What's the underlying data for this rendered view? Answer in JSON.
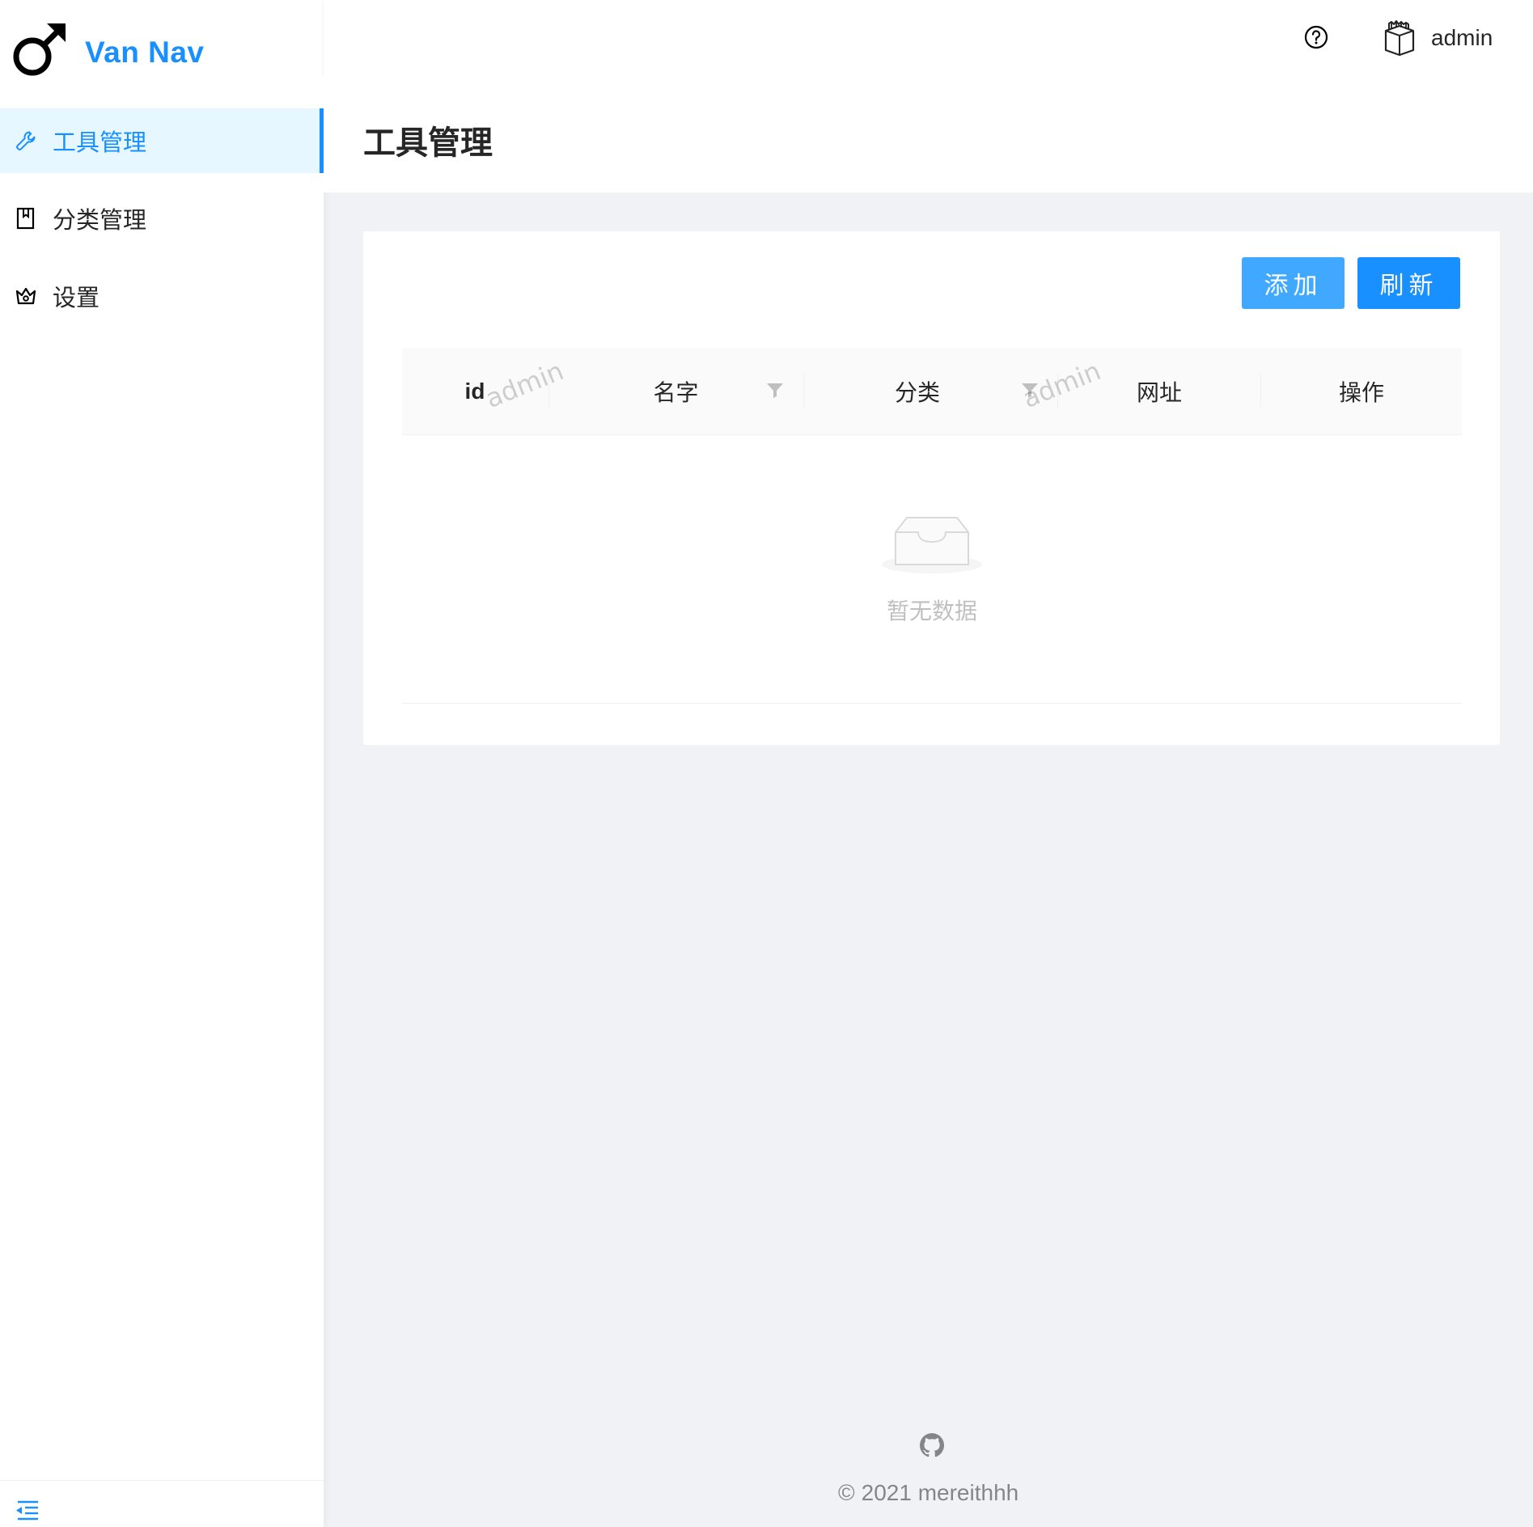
{
  "app": {
    "title": "Van Nav",
    "logo_icon": "mars-symbol-icon"
  },
  "sidebar": {
    "items": [
      {
        "label": "工具管理",
        "icon": "tool-icon",
        "active": true
      },
      {
        "label": "分类管理",
        "icon": "book-icon",
        "active": false
      },
      {
        "label": "设置",
        "icon": "crown-icon",
        "active": false
      }
    ],
    "collapse_icon": "menu-fold-icon"
  },
  "header": {
    "help_icon": "question-circle-icon",
    "avatar_icon": "avatar-icon",
    "username": "admin"
  },
  "page": {
    "title": "工具管理"
  },
  "toolbar": {
    "add_label": "添加",
    "refresh_label": "刷新"
  },
  "table": {
    "columns": [
      {
        "label": "id",
        "filterable": false
      },
      {
        "label": "名字",
        "filterable": true
      },
      {
        "label": "分类",
        "filterable": true
      },
      {
        "label": "网址",
        "filterable": false
      },
      {
        "label": "操作",
        "filterable": false
      }
    ],
    "watermark": "admin",
    "empty_text": "暂无数据"
  },
  "footer": {
    "github_icon": "github-icon",
    "copyright_symbol": "©",
    "copyright": "2021 mereithhh"
  },
  "colors": {
    "primary": "#1890ff",
    "primary_light": "#40a9ff",
    "active_bg": "#e6f7ff",
    "page_bg": "#f0f2f5"
  }
}
